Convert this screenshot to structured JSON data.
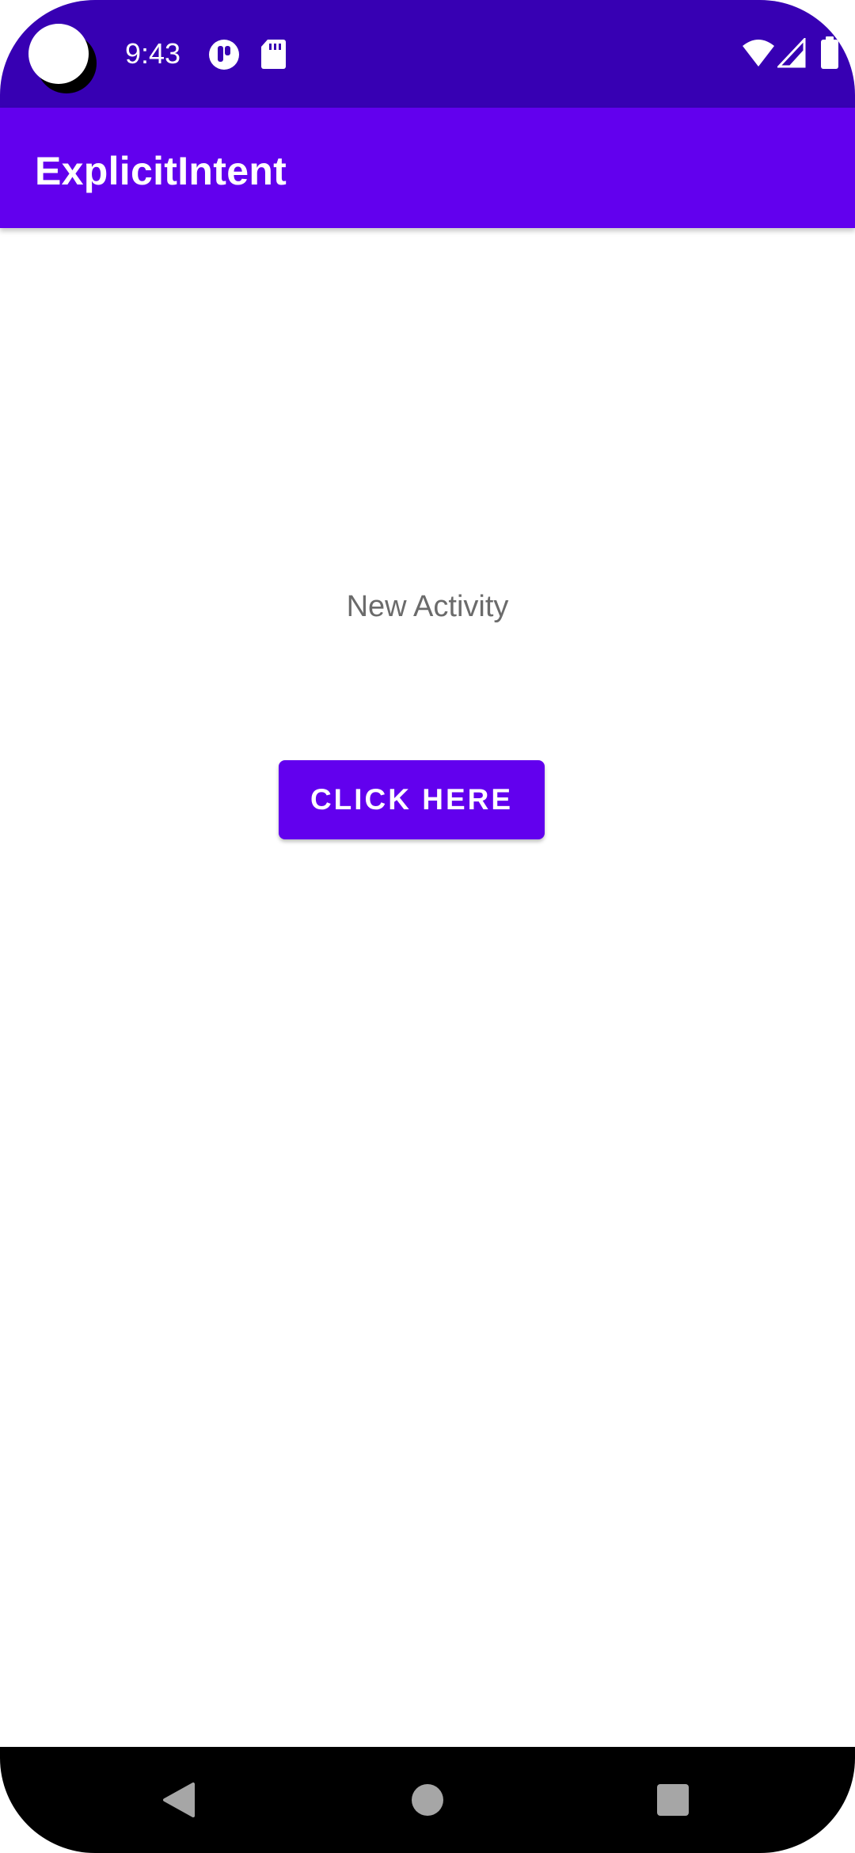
{
  "status_bar": {
    "time": "9:43",
    "background": "#3700b3",
    "icons": [
      "notification-icon",
      "sd-card-icon",
      "wifi-icon",
      "signal-icon",
      "battery-icon"
    ]
  },
  "app_bar": {
    "title": "ExplicitIntent",
    "background": "#6200ee"
  },
  "content": {
    "message": "New Activity",
    "button_label": "CLICK HERE",
    "button_color": "#6200ee"
  },
  "nav_bar": {
    "buttons": [
      "back-icon",
      "home-icon",
      "recents-icon"
    ]
  }
}
